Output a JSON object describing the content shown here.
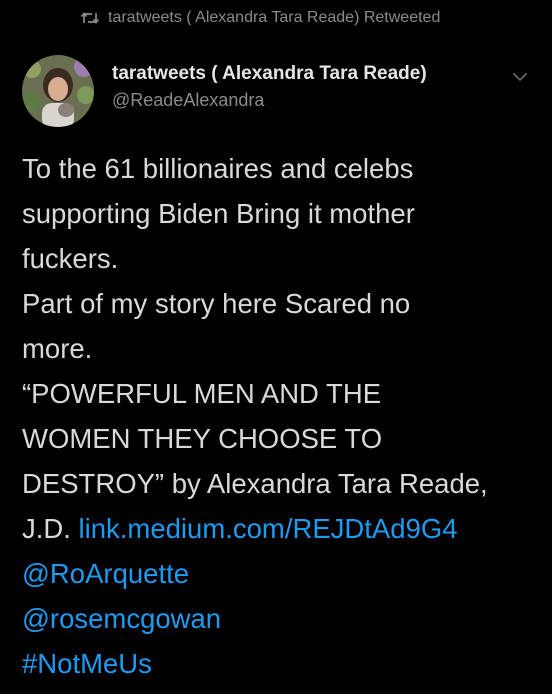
{
  "retweet": {
    "text": "taratweets ( Alexandra Tara Reade) Retweeted",
    "icon": "retweet-icon"
  },
  "author": {
    "name": "taratweets ( Alexandra Tara Reade)",
    "handle": "@ReadeAlexandra",
    "avatar_icon": "avatar"
  },
  "menu": {
    "icon": "chevron-down-icon"
  },
  "tweet": {
    "line1": "To the 61 billionaires and celebs",
    "line2": "supporting Biden Bring it mother",
    "line3": "fuckers.",
    "line4": "Part of my story here Scared no",
    "line5": "more.",
    "line6": "“POWERFUL MEN AND THE",
    "line7": "WOMEN THEY CHOOSE TO",
    "line8": "DESTROY” by Alexandra Tara Reade,",
    "line9_prefix": "J.D. ",
    "link_url": "link.medium.com/REJDtAd9G4",
    "mention1": "@RoArquette",
    "mention2": "@rosemcgowan",
    "hashtag": "#NotMeUs"
  },
  "colors": {
    "background": "#000000",
    "text": "#d9d9d9",
    "muted": "#8b8b8b",
    "link": "#1d9bf0"
  }
}
